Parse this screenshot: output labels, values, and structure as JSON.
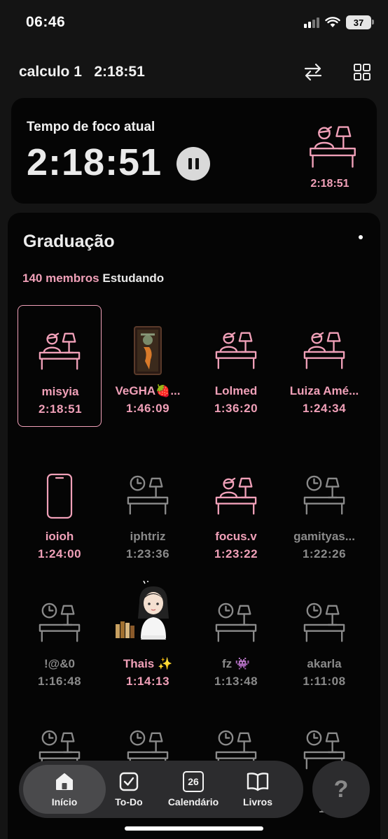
{
  "status_bar": {
    "time": "06:46",
    "battery": "37"
  },
  "header": {
    "title": "calculo 1   2:18:51"
  },
  "focus": {
    "label": "Tempo de foco atual",
    "time": "2:18:51",
    "avatar_time": "2:18:51"
  },
  "group": {
    "title": "Graduação",
    "members_count": "140 membros",
    "members_status": "Estudando"
  },
  "members": [
    {
      "name": "misyia",
      "time": "2:18:51",
      "state": "active",
      "icon": "desk-person-icon",
      "selected": true
    },
    {
      "name": "VeGHA🍓...",
      "time": "1:46:09",
      "state": "active",
      "icon": "photo-avatar-icon"
    },
    {
      "name": "Lolmed",
      "time": "1:36:20",
      "state": "active",
      "icon": "desk-person-icon"
    },
    {
      "name": "Luiza Amé...",
      "time": "1:24:34",
      "state": "active",
      "icon": "desk-person-icon"
    },
    {
      "name": "ioioh",
      "time": "1:24:00",
      "state": "active",
      "icon": "phone-icon"
    },
    {
      "name": "iphtriz",
      "time": "1:23:36",
      "state": "idle",
      "icon": "desk-clock-icon"
    },
    {
      "name": "focus.v",
      "time": "1:23:22",
      "state": "active",
      "icon": "desk-person-icon"
    },
    {
      "name": "gamityas...",
      "time": "1:22:26",
      "state": "idle",
      "icon": "desk-clock-icon"
    },
    {
      "name": "!@&0",
      "time": "1:16:48",
      "state": "idle",
      "icon": "desk-clock-icon"
    },
    {
      "name": "Thais ✨",
      "time": "1:14:13",
      "state": "active",
      "icon": "girl-reading-icon"
    },
    {
      "name": "fz 👾",
      "time": "1:13:48",
      "state": "idle",
      "icon": "desk-clock-icon"
    },
    {
      "name": "akarla",
      "time": "1:11:08",
      "state": "idle",
      "icon": "desk-clock-icon"
    },
    {
      "name": "",
      "time": "",
      "state": "idle",
      "icon": "desk-clock-icon"
    },
    {
      "name": "",
      "time": "",
      "state": "idle",
      "icon": "desk-clock-icon"
    },
    {
      "name": "",
      "time": "",
      "state": "idle",
      "icon": "desk-clock-icon"
    },
    {
      "name": "@",
      "time": "1:",
      "state": "idle",
      "icon": "desk-clock-icon"
    }
  ],
  "nav": {
    "items": [
      {
        "label": "Início",
        "icon": "home-icon"
      },
      {
        "label": "To-Do",
        "icon": "checkbox-icon"
      },
      {
        "label": "Calendário",
        "icon": "calendar-icon",
        "badge": "26"
      },
      {
        "label": "Livros",
        "icon": "book-icon"
      }
    ],
    "help": "?"
  },
  "colors": {
    "accent": "#f0a0b8",
    "idle": "#8a8a8a",
    "background": "#141414",
    "card": "#050505"
  }
}
